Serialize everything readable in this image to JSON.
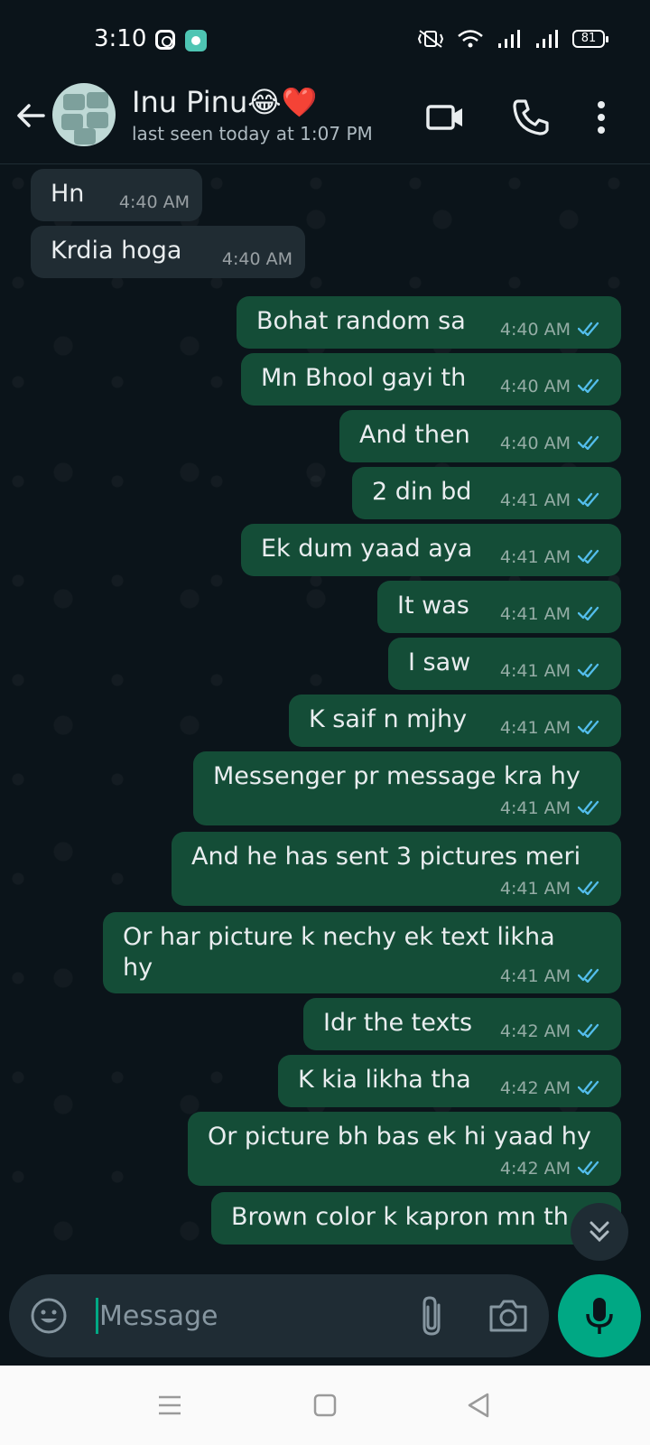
{
  "status_bar": {
    "time": "3:10",
    "battery": "81"
  },
  "header": {
    "contact_name": "Inu Pinu😂❤️",
    "last_seen": "last seen today at 1:07 PM"
  },
  "messages": [
    {
      "dir": "in",
      "text": "Hn",
      "time": "4:40 AM"
    },
    {
      "dir": "in",
      "text": "Krdia hoga",
      "time": "4:40 AM"
    },
    {
      "dir": "out",
      "text": "Bohat random sa",
      "time": "4:40 AM"
    },
    {
      "dir": "out",
      "text": "Mn Bhool gayi th",
      "time": "4:40 AM"
    },
    {
      "dir": "out",
      "text": "And then",
      "time": "4:40 AM"
    },
    {
      "dir": "out",
      "text": "2 din bd",
      "time": "4:41 AM"
    },
    {
      "dir": "out",
      "text": "Ek dum yaad aya",
      "time": "4:41 AM"
    },
    {
      "dir": "out",
      "text": "It was",
      "time": "4:41 AM"
    },
    {
      "dir": "out",
      "text": "I saw",
      "time": "4:41 AM"
    },
    {
      "dir": "out",
      "text": "K saif n mjhy",
      "time": "4:41 AM"
    },
    {
      "dir": "out",
      "text": "Messenger pr message kra hy",
      "time": "4:41 AM"
    },
    {
      "dir": "out",
      "text": "And he has sent 3 pictures meri",
      "time": "4:41 AM"
    },
    {
      "dir": "out",
      "text": "Or har picture k nechy ek text likha",
      "text2": "hy",
      "time": "4:41 AM"
    },
    {
      "dir": "out",
      "text": "Idr the texts",
      "time": "4:42 AM"
    },
    {
      "dir": "out",
      "text": "K kia likha tha",
      "time": "4:42 AM"
    },
    {
      "dir": "out",
      "text": "Or picture bh bas ek hi yaad hy",
      "time": "4:42 AM"
    },
    {
      "dir": "out",
      "text": "Brown color k kapron mn th",
      "time": ""
    }
  ],
  "composer": {
    "placeholder": "Message"
  },
  "colors": {
    "incoming": "#202c33",
    "outgoing": "#144d37",
    "accent": "#00a884",
    "read_ticks": "#53bdeb"
  },
  "icons": [
    "back-arrow-icon",
    "video-call-icon",
    "voice-call-icon",
    "more-options-icon",
    "emoji-icon",
    "attach-icon",
    "camera-icon",
    "mic-icon",
    "scroll-down-icon"
  ]
}
